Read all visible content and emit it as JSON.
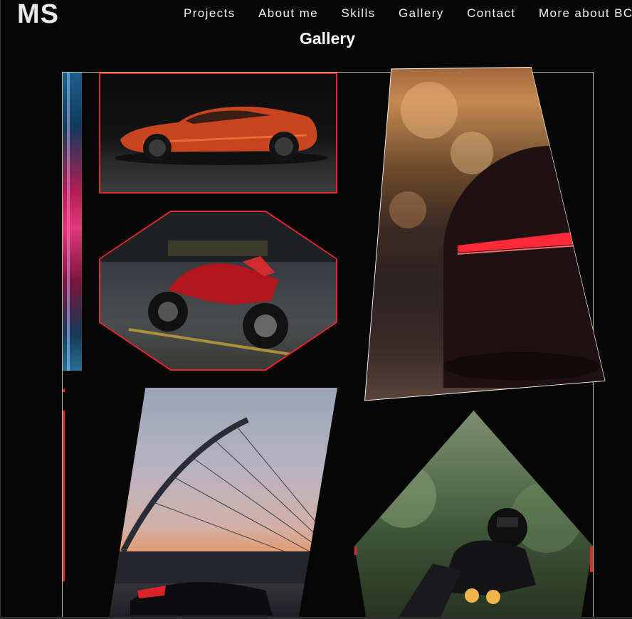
{
  "header": {
    "logo": "MS",
    "nav": [
      "Projects",
      "About me",
      "Skills",
      "Gallery",
      "Contact",
      "More about BCI"
    ]
  },
  "gallery": {
    "title": "Gallery",
    "images": [
      {
        "name": "cropped-left-image"
      },
      {
        "name": "orange-sports-car"
      },
      {
        "name": "red-motorcycle"
      },
      {
        "name": "red-car-taillights"
      },
      {
        "name": "bridge-motorcycle"
      },
      {
        "name": "motorcycle-rider"
      }
    ]
  },
  "colors": {
    "background": "#060606",
    "accent_red": "#e2262d",
    "frame_border": "#b7c98f",
    "text": "#ffffff"
  }
}
